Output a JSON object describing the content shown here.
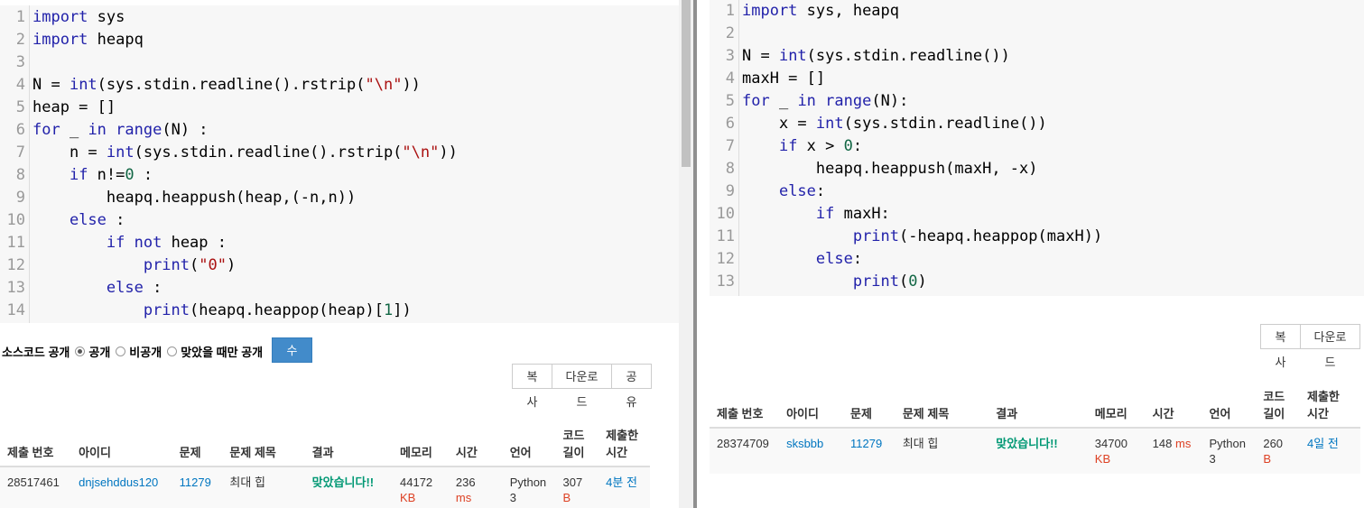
{
  "left": {
    "code_lines": [
      {
        "n": "1",
        "html": "<span class=\"kwd\">import</span> sys"
      },
      {
        "n": "2",
        "html": "<span class=\"kwd\">import</span> heapq"
      },
      {
        "n": "3",
        "html": ""
      },
      {
        "n": "4",
        "html": "N = <span class=\"kwd\">int</span>(sys.stdin.readline().rstrip(<span class=\"str\">\"\\n\"</span>))"
      },
      {
        "n": "5",
        "html": "heap = []"
      },
      {
        "n": "6",
        "html": "<span class=\"kwd\">for</span> _ <span class=\"kwd\">in</span> <span class=\"kwd\">range</span>(N) :"
      },
      {
        "n": "7",
        "html": "    n = <span class=\"kwd\">int</span>(sys.stdin.readline().rstrip(<span class=\"str\">\"\\n\"</span>))"
      },
      {
        "n": "8",
        "html": "    <span class=\"kwd\">if</span> n!=<span class=\"num\">0</span> :"
      },
      {
        "n": "9",
        "html": "        heapq.heappush(heap,(-n,n))"
      },
      {
        "n": "10",
        "html": "    <span class=\"kwd\">else</span> :"
      },
      {
        "n": "11",
        "html": "        <span class=\"kwd\">if</span> <span class=\"kwd\">not</span> heap :"
      },
      {
        "n": "12",
        "html": "            <span class=\"kwd\">print</span>(<span class=\"str\">\"0\"</span>)"
      },
      {
        "n": "13",
        "html": "        <span class=\"kwd\">else</span> :"
      },
      {
        "n": "14",
        "html": "            <span class=\"kwd\">print</span>(heapq.heappop(heap)[<span class=\"num\">1</span>])"
      }
    ],
    "visibility": {
      "label": "소스코드 공개",
      "options": [
        "공개",
        "비공개",
        "맞았을 때만 공개"
      ],
      "selected": 0,
      "submit": "수정"
    },
    "buttons": [
      "복사",
      "다운로드",
      "공유"
    ],
    "table": {
      "headers": [
        "제출 번호",
        "아이디",
        "문제",
        "문제 제목",
        "결과",
        "메모리",
        "시간",
        "언어",
        "코드 길이",
        "제출한 시간"
      ],
      "row": {
        "id": "28517461",
        "user": "dnjsehddus120",
        "problem": "11279",
        "title": "최대 힙",
        "result": "맞았습니다!!",
        "memory": "44172",
        "memory_unit": "KB",
        "time": "236",
        "time_unit": "ms",
        "lang": "Python 3",
        "length": "307",
        "length_unit": "B",
        "submitted": "4분 전"
      }
    }
  },
  "right": {
    "code_lines": [
      {
        "n": "1",
        "html": "<span class=\"kwd\">import</span> sys, heapq"
      },
      {
        "n": "2",
        "html": ""
      },
      {
        "n": "3",
        "html": "N = <span class=\"kwd\">int</span>(sys.stdin.readline())"
      },
      {
        "n": "4",
        "html": "maxH = []"
      },
      {
        "n": "5",
        "html": "<span class=\"kwd\">for</span> _ <span class=\"kwd\">in</span> <span class=\"kwd\">range</span>(N):"
      },
      {
        "n": "6",
        "html": "    x = <span class=\"kwd\">int</span>(sys.stdin.readline())"
      },
      {
        "n": "7",
        "html": "    <span class=\"kwd\">if</span> x &gt; <span class=\"num\">0</span>:"
      },
      {
        "n": "8",
        "html": "        heapq.heappush(maxH, -x)"
      },
      {
        "n": "9",
        "html": "    <span class=\"kwd\">else</span>:"
      },
      {
        "n": "10",
        "html": "        <span class=\"kwd\">if</span> maxH:"
      },
      {
        "n": "11",
        "html": "            <span class=\"kwd\">print</span>(-heapq.heappop(maxH))"
      },
      {
        "n": "12",
        "html": "        <span class=\"kwd\">else</span>:"
      },
      {
        "n": "13",
        "html": "            <span class=\"kwd\">print</span>(<span class=\"num\">0</span>)"
      }
    ],
    "buttons": [
      "복사",
      "다운로드"
    ],
    "table": {
      "headers": [
        "제출 번호",
        "아이디",
        "문제",
        "문제 제목",
        "결과",
        "메모리",
        "시간",
        "언어",
        "코드 길이",
        "제출한 시간"
      ],
      "row": {
        "id": "28374709",
        "user": "sksbbb",
        "problem": "11279",
        "title": "최대 힙",
        "result": "맞았습니다!!",
        "memory": "34700",
        "memory_unit": "KB",
        "time": "148",
        "time_unit": "ms",
        "lang": "Python 3",
        "length": "260",
        "length_unit": "B",
        "submitted": "4일 전"
      }
    }
  }
}
